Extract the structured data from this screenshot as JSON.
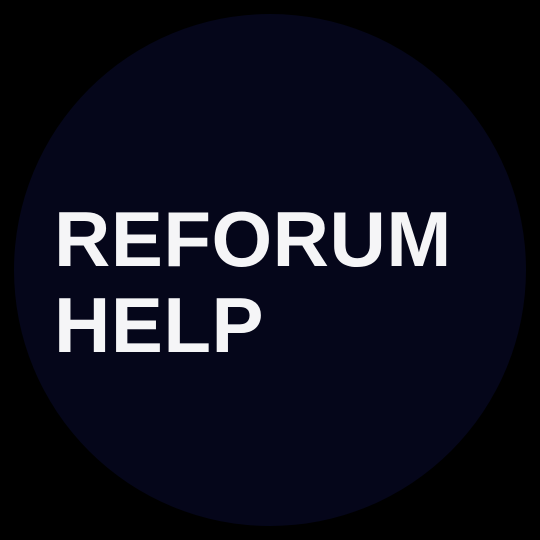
{
  "logo": {
    "line1": "REFORUM",
    "line2": "HELP"
  },
  "colors": {
    "background": "#000000",
    "circle": "#05061a",
    "text": "#f5f5f7"
  }
}
